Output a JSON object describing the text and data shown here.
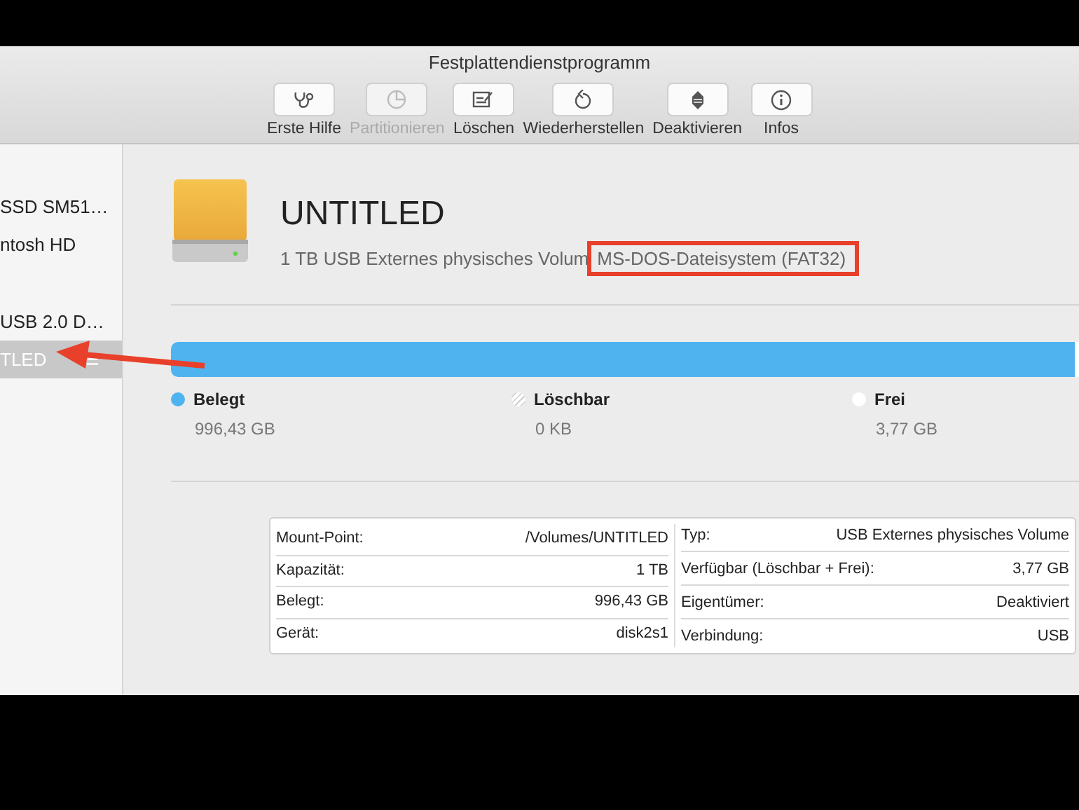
{
  "window": {
    "title": "Festplattendienstprogramm"
  },
  "toolbar": [
    {
      "label": "Erste Hilfe",
      "kind": "firstaid",
      "disabled": false
    },
    {
      "label": "Partitionieren",
      "kind": "partition",
      "disabled": true
    },
    {
      "label": "Löschen",
      "kind": "erase",
      "disabled": false
    },
    {
      "label": "Wiederherstellen",
      "kind": "restore",
      "disabled": false
    },
    {
      "label": "Deaktivieren",
      "kind": "unmount",
      "disabled": false
    },
    {
      "label": "Infos",
      "kind": "info",
      "disabled": false
    }
  ],
  "sidebar": {
    "sections": [
      {
        "items": [
          {
            "label": "SSD SM51…",
            "selected": false,
            "eject": false
          },
          {
            "label": "ntosh HD",
            "selected": false,
            "eject": false
          }
        ]
      },
      {
        "items": [
          {
            "label": "USB 2.0 D…",
            "selected": false,
            "eject": false
          },
          {
            "label": "TLED",
            "selected": true,
            "eject": true
          }
        ]
      }
    ]
  },
  "volume": {
    "name": "UNTITLED",
    "description": "1 TB USB Externes physisches Volum",
    "filesystem": "MS-DOS-Dateisystem (FAT32)"
  },
  "usage": {
    "level": 0.996,
    "legend": [
      {
        "label": "Belegt",
        "value": "996,43 GB",
        "color": "#4fb3f0",
        "kind": "solid"
      },
      {
        "label": "Löschbar",
        "value": "0 KB",
        "color": "#ffffff",
        "kind": "hatched"
      },
      {
        "label": "Frei",
        "value": "3,77 GB",
        "color": "#ffffff",
        "kind": "solid"
      }
    ]
  },
  "info": {
    "left": [
      {
        "label": "Mount-Point:",
        "value": "/Volumes/UNTITLED"
      },
      {
        "label": "Kapazität:",
        "value": "1 TB"
      },
      {
        "label": "Belegt:",
        "value": "996,43 GB"
      },
      {
        "label": "Gerät:",
        "value": "disk2s1"
      }
    ],
    "right": [
      {
        "label": "Typ:",
        "value": "USB Externes physisches Volume"
      },
      {
        "label": "Verfügbar (Löschbar + Frei):",
        "value": "3,77 GB"
      },
      {
        "label": "Eigentümer:",
        "value": "Deaktiviert"
      },
      {
        "label": "Verbindung:",
        "value": "USB"
      }
    ]
  }
}
